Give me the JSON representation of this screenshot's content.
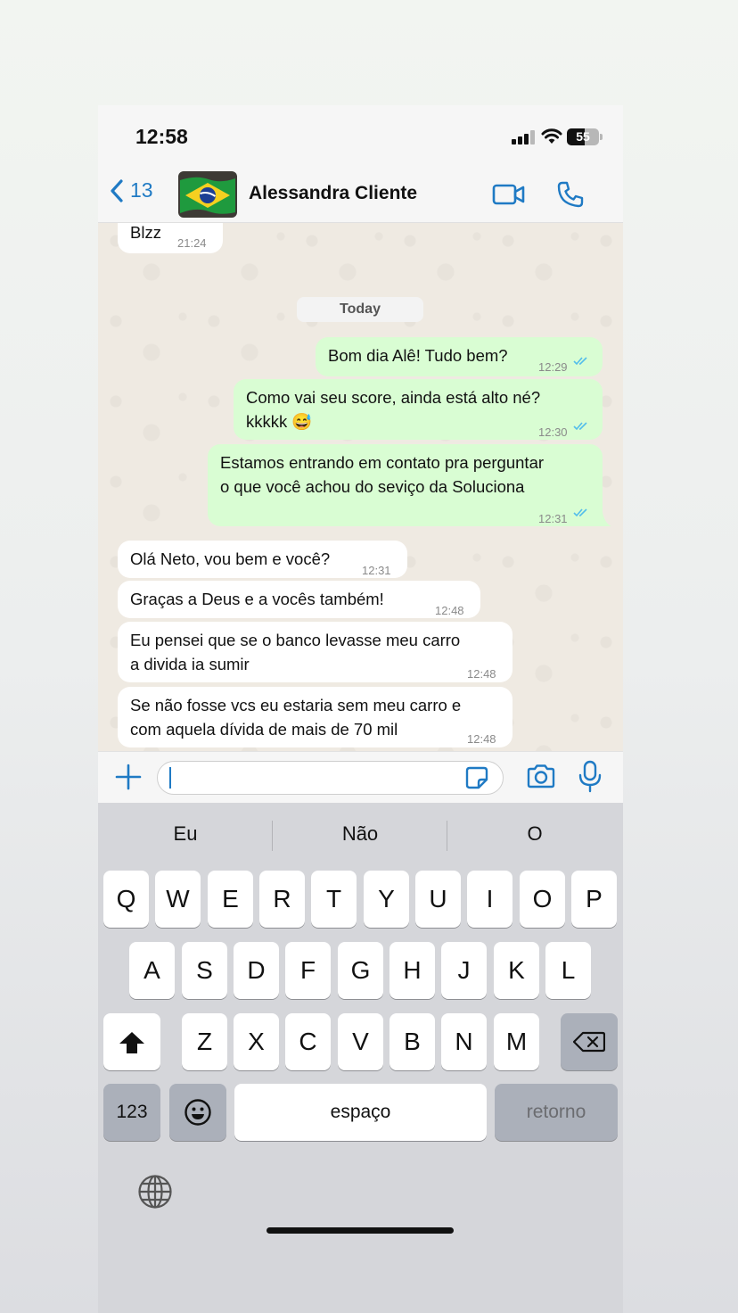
{
  "status_bar": {
    "time": "12:58",
    "battery": "55",
    "icons": [
      "signal-icon",
      "wifi-icon",
      "battery-icon"
    ]
  },
  "header": {
    "back_count": "13",
    "contact_name": "Alessandra Cliente",
    "icons": [
      "chevron-left-icon",
      "brazil-flag-avatar",
      "video-call-icon",
      "phone-icon"
    ],
    "accent": "#1f7ac4"
  },
  "chat": {
    "day_label": "Today",
    "messages": [
      {
        "dir": "in",
        "text": [
          "Blzz"
        ],
        "time": "21:24"
      },
      {
        "dir": "out",
        "text": [
          "Bom dia Alê! Tudo bem?"
        ],
        "time": "12:29",
        "read": true
      },
      {
        "dir": "out",
        "text": [
          "Como vai seu score, ainda está alto né?",
          "kkkkk 😅"
        ],
        "time": "12:30",
        "read": true
      },
      {
        "dir": "out",
        "text": [
          "Estamos entrando em contato pra perguntar",
          "o que você achou do seviço da Soluciona"
        ],
        "time": "12:31",
        "read": true
      },
      {
        "dir": "in",
        "text": [
          "Olá Neto, vou bem e você?"
        ],
        "time": "12:31"
      },
      {
        "dir": "in",
        "text": [
          "Graças a Deus e a vocês também!"
        ],
        "time": "12:48"
      },
      {
        "dir": "in",
        "text": [
          "Eu pensei que se o banco levasse meu carro",
          "a divida ia sumir"
        ],
        "time": "12:48"
      },
      {
        "dir": "in",
        "text": [
          "Se não fosse vcs eu estaria sem meu carro e",
          "com aquela dívida de mais de 70 mil"
        ],
        "time": "12:48"
      }
    ],
    "colors": {
      "incoming": "#ffffff",
      "outgoing": "#d9fdd3",
      "read_tick": "#53bdeb",
      "background": "#efeae2"
    }
  },
  "input_bar": {
    "value": "",
    "icons": [
      "plus-icon",
      "sticker-icon",
      "camera-icon",
      "microphone-icon"
    ]
  },
  "keyboard": {
    "suggestions": [
      "Eu",
      "Não",
      "O"
    ],
    "row1": [
      "Q",
      "W",
      "E",
      "R",
      "T",
      "Y",
      "U",
      "I",
      "O",
      "P"
    ],
    "row2": [
      "A",
      "S",
      "D",
      "F",
      "G",
      "H",
      "J",
      "K",
      "L"
    ],
    "row3": [
      "Z",
      "X",
      "C",
      "V",
      "B",
      "N",
      "M"
    ],
    "numbers_label": "123",
    "space_label": "espaço",
    "return_label": "retorno",
    "icons": [
      "shift-icon",
      "backspace-icon",
      "emoji-icon",
      "globe-icon"
    ]
  }
}
